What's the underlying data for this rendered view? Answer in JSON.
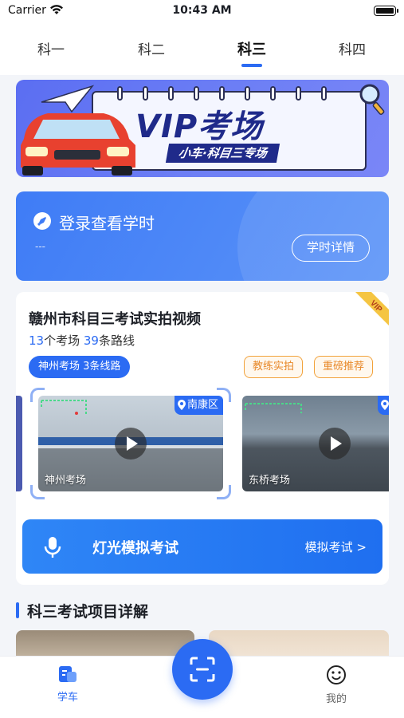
{
  "status": {
    "carrier": "Carrier",
    "time": "10:43 AM"
  },
  "tabs": [
    {
      "label": "科一",
      "active": false
    },
    {
      "label": "科二",
      "active": false
    },
    {
      "label": "科三",
      "active": true
    },
    {
      "label": "科四",
      "active": false
    }
  ],
  "banner": {
    "title": "VIP考场",
    "subtitle": "小车·科目三专场"
  },
  "login": {
    "text": "登录查看学时",
    "sub": "---",
    "button": "学时详情"
  },
  "video_card": {
    "badge": "VIP",
    "title": "赣州市科目三考试实拍视频",
    "stats": {
      "venues_count": "13",
      "venues_label": "个考场",
      "routes_count": "39",
      "routes_label": "条路线"
    },
    "route_chip": "神州考场 3条线路",
    "tags": [
      "教练实拍",
      "重磅推荐"
    ],
    "videos": [
      {
        "name": "神州考场",
        "location": "南康区"
      },
      {
        "name": "东桥考场",
        "location": ""
      }
    ],
    "light_exam": {
      "title": "灯光模拟考试",
      "link": "模拟考试 >"
    }
  },
  "section": {
    "title": "科三考试项目详解"
  },
  "tabbar": {
    "items": [
      {
        "label": "学车",
        "active": true
      },
      {
        "label": "我的",
        "active": false
      }
    ]
  },
  "colors": {
    "primary": "#2b6bf3",
    "tag_orange": "#e8892a",
    "banner_navy": "#1f2a8a"
  }
}
